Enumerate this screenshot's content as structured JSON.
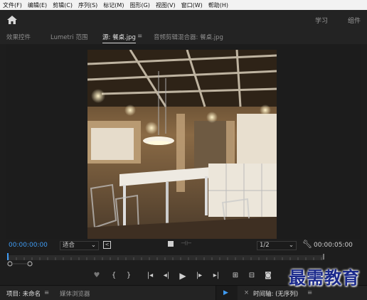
{
  "menu": [
    "文件(F)",
    "编辑(E)",
    "剪辑(C)",
    "序列(S)",
    "标记(M)",
    "图形(G)",
    "视图(V)",
    "窗口(W)",
    "帮助(H)"
  ],
  "header": {
    "tabs": [
      "学习",
      "组件"
    ]
  },
  "panel_tabs": {
    "effect_controls": "效果控件",
    "lumetri": "Lumetri 范围",
    "source": "源: 餐桌.jpg",
    "audio_mixer": "音频剪辑混合器: 餐桌.jpg"
  },
  "monitor": {
    "timecode_current": "00:00:00:00",
    "fit": "适合",
    "resolution": "1/2",
    "timecode_duration": "00:00:05:00"
  },
  "bottom": {
    "project": "项目: 未命名",
    "media_browser": "媒体浏览器",
    "timeline": "时间轴: (无序列)"
  },
  "watermark": "最需教育",
  "colors": {
    "accent_timecode": "#3f9bf2",
    "playhead": "#3f9bf2"
  }
}
